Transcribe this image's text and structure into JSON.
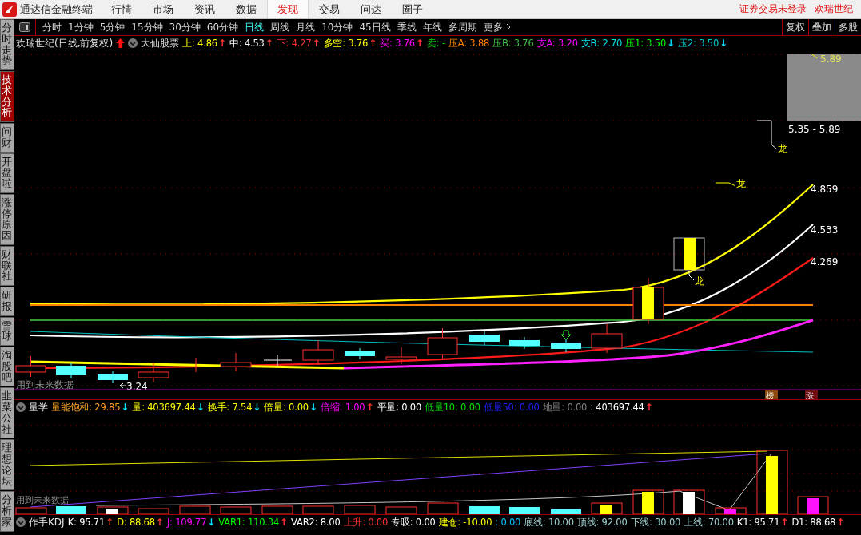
{
  "app": {
    "title": "通达信金融终端"
  },
  "menu": [
    {
      "label": "行情",
      "selected": false
    },
    {
      "label": "市场",
      "selected": false
    },
    {
      "label": "资讯",
      "selected": false
    },
    {
      "label": "数据",
      "selected": false
    },
    {
      "label": "发现",
      "selected": true
    },
    {
      "label": "交易",
      "selected": false
    },
    {
      "label": "问达",
      "selected": false
    },
    {
      "label": "圈子",
      "selected": false
    }
  ],
  "status_links": [
    "证券交易未登录",
    "欢瑞世纪"
  ],
  "sidebar": [
    {
      "label": "分时走势",
      "selected": false
    },
    {
      "label": "技术分析",
      "selected": true
    },
    {
      "label": "问财",
      "selected": false
    },
    {
      "label": "开盘啦",
      "selected": false
    },
    {
      "label": "涨停原因",
      "selected": false
    },
    {
      "label": "财联社",
      "selected": false
    },
    {
      "label": "研报",
      "selected": false
    },
    {
      "label": "雪球",
      "selected": false
    },
    {
      "label": "淘股吧",
      "selected": false
    },
    {
      "label": "韭菜公社",
      "selected": false
    },
    {
      "label": "理想论坛",
      "selected": false
    },
    {
      "label": "分析家",
      "selected": false
    }
  ],
  "periods": [
    {
      "label": "分时",
      "selected": false
    },
    {
      "label": "1分钟",
      "selected": false
    },
    {
      "label": "5分钟",
      "selected": false
    },
    {
      "label": "15分钟",
      "selected": false
    },
    {
      "label": "30分钟",
      "selected": false
    },
    {
      "label": "60分钟",
      "selected": false
    },
    {
      "label": "日线",
      "selected": true
    },
    {
      "label": "周线",
      "selected": false
    },
    {
      "label": "月线",
      "selected": false
    },
    {
      "label": "10分钟",
      "selected": false
    },
    {
      "label": "45日线",
      "selected": false
    },
    {
      "label": "季线",
      "selected": false
    },
    {
      "label": "年线",
      "selected": false
    },
    {
      "label": "多周期",
      "selected": false
    },
    {
      "label": "更多",
      "selected": false
    }
  ],
  "tools": [
    "复权",
    "叠加",
    "多股"
  ],
  "main_chart": {
    "title": "欢瑞世纪(日线,前复权)",
    "indicator": "大仙股票",
    "readings": [
      {
        "label": "上:",
        "value": "4.86",
        "color": "#ffff00",
        "arrow": "↑",
        "rising": true
      },
      {
        "label": "中:",
        "value": "4.53",
        "color": "#ffffff",
        "arrow": "↑",
        "rising": true
      },
      {
        "label": "下:",
        "value": "4.27",
        "color": "#ff3030",
        "arrow": "↑",
        "rising": true
      },
      {
        "label": "多空:",
        "value": "3.76",
        "color": "#ffff00",
        "arrow": "↑",
        "rising": true
      },
      {
        "label": "买:",
        "value": "3.76",
        "color": "#ff00ff",
        "arrow": "↑",
        "rising": true
      },
      {
        "label": "卖:",
        "value": "-",
        "color": "#00e000"
      },
      {
        "label": "压A:",
        "value": "3.88",
        "color": "#ff8000"
      },
      {
        "label": "压B:",
        "value": "3.76",
        "color": "#40c040"
      },
      {
        "label": "支A:",
        "value": "3.20",
        "color": "#ff00ff"
      },
      {
        "label": "支B:",
        "value": "2.70",
        "color": "#00e0e0"
      },
      {
        "label": "压1:",
        "value": "3.50",
        "color": "#00ff00",
        "arrow": "↓",
        "rising": false
      },
      {
        "label": "压2:",
        "value": "3.50",
        "color": "#00c8c8",
        "arrow": "↓",
        "rising": false
      }
    ],
    "labels": {
      "high": "5.89",
      "range": "5.35 - 5.89",
      "dragon_top": "龙",
      "dragon_mid": "龙",
      "dragon_low": "龙",
      "upper": "4.859",
      "middle": "4.533",
      "lower": "4.269",
      "low": "3.24",
      "future_note": "用到未来数据"
    },
    "tags": [
      "榜",
      "涨"
    ]
  },
  "volume_panel": {
    "indicator": "量学",
    "readings": [
      {
        "label": "量能饱和:",
        "value": "29.85",
        "color": "#ffa020",
        "arrow": "↓",
        "rising": false
      },
      {
        "label": "量:",
        "value": "403697.44",
        "color": "#ffff00",
        "arrow": "↓",
        "rising": false
      },
      {
        "label": "换手:",
        "value": "7.54",
        "color": "#ffff00",
        "arrow": "↓",
        "rising": false
      },
      {
        "label": "倍量:",
        "value": "0.00",
        "color": "#ffff00",
        "arrow": "↓",
        "rising": false
      },
      {
        "label": "倍缩:",
        "value": "1.00",
        "color": "#ff00ff",
        "arrow": "↑",
        "rising": true
      },
      {
        "label": "平量:",
        "value": "0.00",
        "color": "#ffffff"
      },
      {
        "label": "低量10:",
        "value": "0.00",
        "color": "#00e000"
      },
      {
        "label": "低量50:",
        "value": "0.00",
        "color": "#2020ff"
      },
      {
        "label": "地量:",
        "value": "0.00",
        "color": "#808080"
      },
      {
        "label": ":",
        "value": "403697.44",
        "color": "#ffffff",
        "arrow": "↑",
        "rising": true
      }
    ],
    "future_note": "用到未来数据"
  },
  "kdj_panel": {
    "indicator": "作手KDJ",
    "readings": [
      {
        "label": "K:",
        "value": "95.71",
        "color": "#ffffff",
        "arrow": "↑",
        "rising": true
      },
      {
        "label": "D:",
        "value": "88.68",
        "color": "#ffff00",
        "arrow": "↑",
        "rising": true
      },
      {
        "label": "J:",
        "value": "109.77",
        "color": "#ff00ff",
        "arrow": "↓",
        "rising": false
      },
      {
        "label": "VAR1:",
        "value": "110.34",
        "color": "#00ff00",
        "arrow": "↑",
        "rising": true
      },
      {
        "label": "VAR2:",
        "value": "8.00",
        "color": "#ffffff"
      },
      {
        "label": "上升:",
        "value": "0.00",
        "color": "#ff3030"
      },
      {
        "label": "专吸:",
        "value": "0.00",
        "color": "#ffffff"
      },
      {
        "label": "建仓:",
        "value": "-10.00",
        "color": "#ffff00"
      },
      {
        "label": ":",
        "value": "0.00",
        "color": "#00c8ff"
      },
      {
        "label": "底线:",
        "value": "10.00",
        "color": "#a0d0d0"
      },
      {
        "label": "顶线:",
        "value": "92.00",
        "color": "#a0d0d0"
      },
      {
        "label": "下线:",
        "value": "30.00",
        "color": "#a0d0d0"
      },
      {
        "label": "上线:",
        "value": "70.00",
        "color": "#a0d0d0"
      },
      {
        "label": "K1:",
        "value": "95.71",
        "color": "#ffffff",
        "arrow": "↑",
        "rising": true
      },
      {
        "label": "D1:",
        "value": "88.68",
        "color": "#ffffff",
        "arrow": "↑",
        "rising": true
      }
    ]
  }
}
